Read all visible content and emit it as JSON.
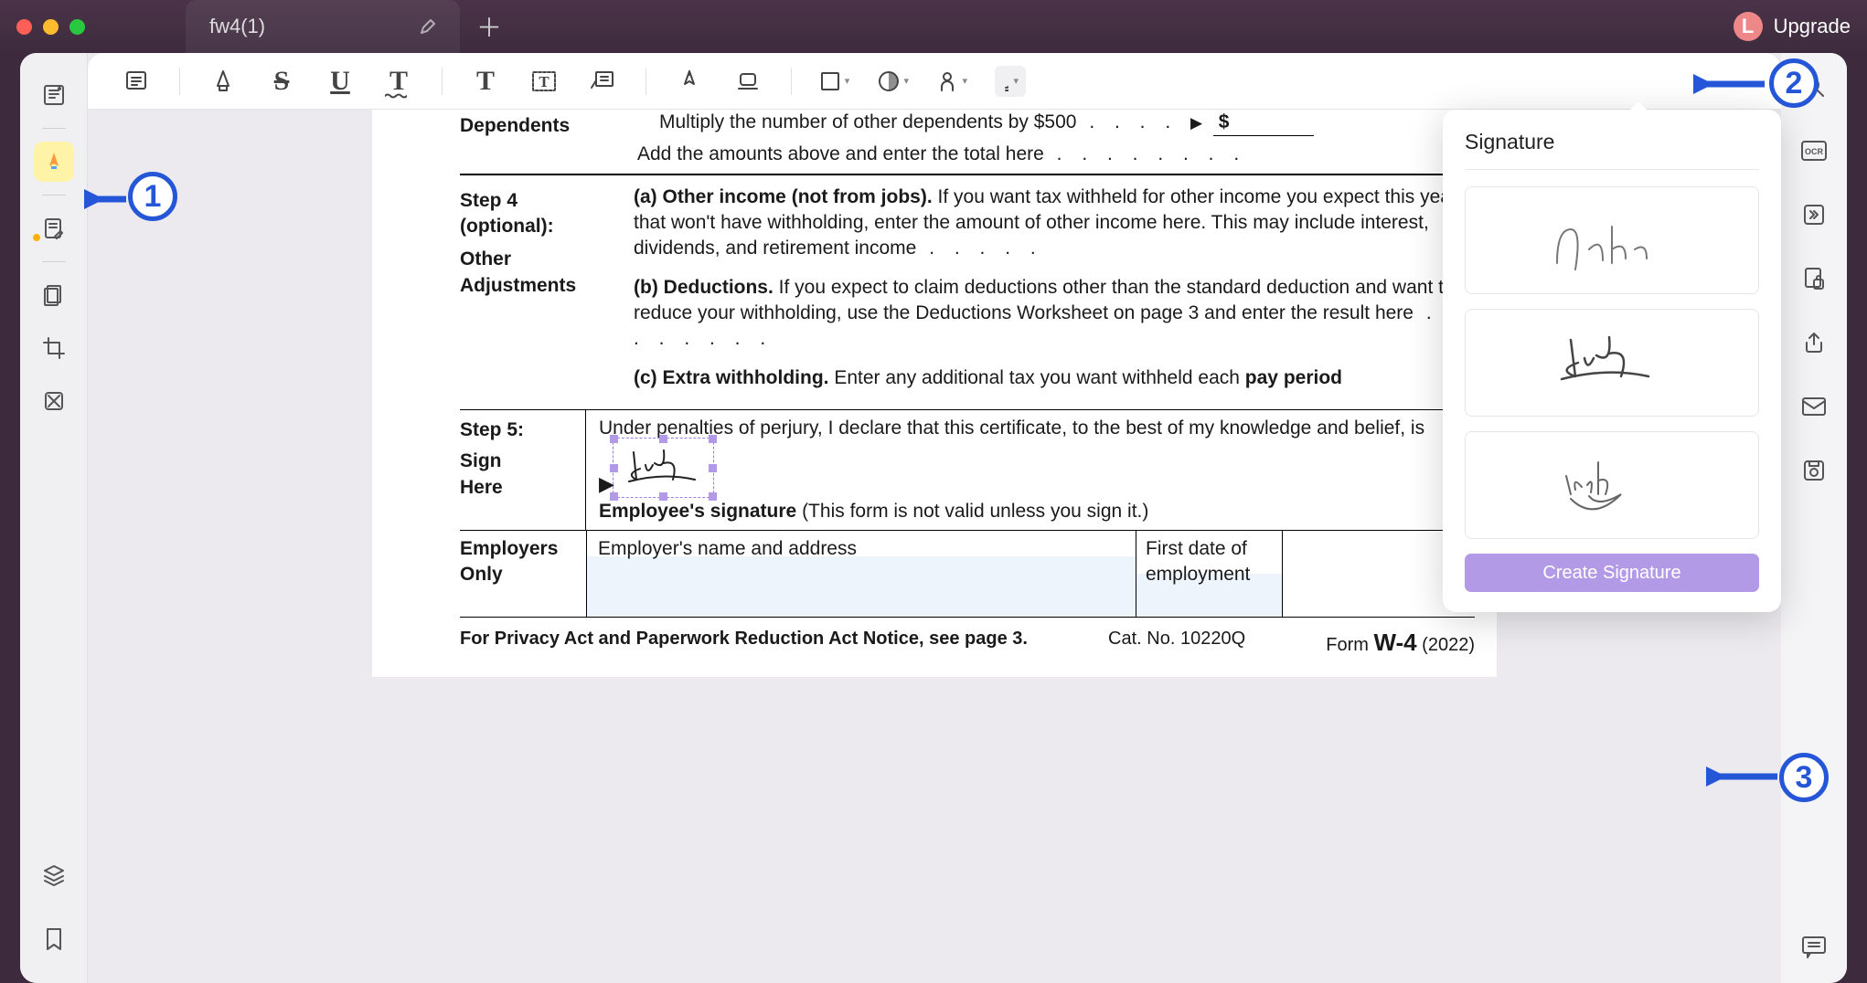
{
  "titlebar": {
    "tab_name": "fw4(1)",
    "upgrade_label": "Upgrade",
    "avatar_initial": "L"
  },
  "callouts": {
    "c1": "1",
    "c2": "2",
    "c3": "3"
  },
  "toolbar_icons": [
    "note",
    "highlighter",
    "strikethrough",
    "underline",
    "text-style",
    "text",
    "text-box",
    "text-align",
    "pencil",
    "eraser",
    "shape",
    "color",
    "stamp",
    "signature"
  ],
  "signature_panel": {
    "title": "Signature",
    "create_label": "Create Signature",
    "items": [
      "John",
      "Vicky",
      "Vick-b"
    ]
  },
  "doc": {
    "dependents_label": "Dependents",
    "mult_line": "Multiply the number of other dependents by $500",
    "add_line": "Add the amounts above and enter the total here",
    "step4_label_a": "Step 4",
    "step4_label_b": "(optional):",
    "other_adj_a": "Other",
    "other_adj_b": "Adjustments",
    "a_lead": "(a) Other income (not from jobs).",
    "a_rest": " If you want tax withheld for other income you expect this year that won't have withholding, enter the amount of other income here. This may include interest, dividends, and retirement income",
    "b_lead": "(b) Deductions.",
    "b_rest": " If you expect to claim deductions other than the standard deduction and want to reduce your withholding, use the Deductions Worksheet on page 3 and enter the result here",
    "c_lead": "(c) Extra withholding.",
    "c_rest_a": " Enter any additional tax you want withheld each ",
    "c_rest_b": "pay period",
    "step5_label": "Step 5:",
    "sign_here_a": "Sign",
    "sign_here_b": "Here",
    "perjury": "Under penalties of perjury, I declare that this certificate, to the best of my knowledge and belief, is ",
    "emp_sig_label_b": "Employee's signature",
    "emp_sig_label_rest": " (This form is not valid unless you sign it.)",
    "employers_a": "Employers",
    "employers_b": "Only",
    "emp_name": "Employer's name and address",
    "first_date_a": "First date of",
    "first_date_b": "employment",
    "privacy": "For Privacy Act and Paperwork Reduction Act Notice, see page 3.",
    "catno": "Cat. No. 10220Q",
    "form_word": "Form ",
    "form_code": "W-4",
    "form_year": " (2022)",
    "dollar": "$"
  }
}
